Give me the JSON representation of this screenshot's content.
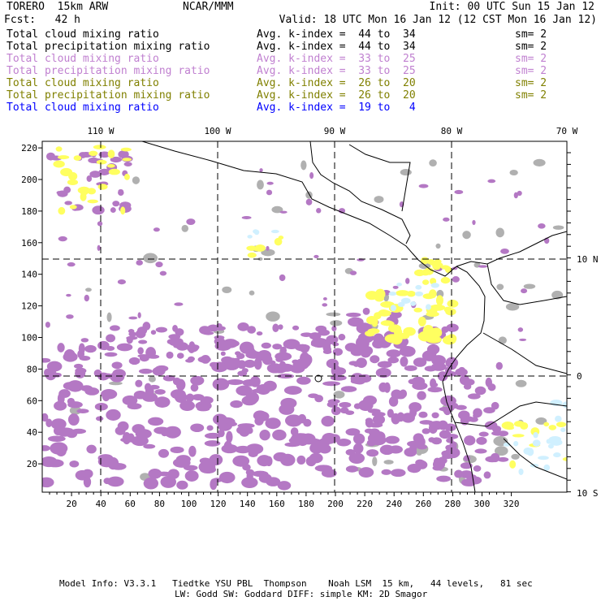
{
  "header": {
    "model": "TORERO  15km ARW",
    "org": "NCAR/MMM",
    "init": "Init: 00 UTC Sun 15 Jan 12",
    "fcst": "Fcst:   42 h",
    "valid": "Valid: 18 UTC Mon 16 Jan 12 (12 CST Mon 16 Jan 12)"
  },
  "legend": [
    {
      "field": "Total cloud mixing ratio",
      "range": "Avg. k-index =  44 to  34",
      "sm": "sm= 2",
      "color": "#000000"
    },
    {
      "field": "Total precipitation mixing ratio",
      "range": "Avg. k-index =  44 to  34",
      "sm": "sm= 2",
      "color": "#000000"
    },
    {
      "field": "Total cloud mixing ratio",
      "range": "Avg. k-index =  33 to  25",
      "sm": "sm= 2",
      "color": "#c080d0"
    },
    {
      "field": "Total precipitation mixing ratio",
      "range": "Avg. k-index =  33 to  25",
      "sm": "sm= 2",
      "color": "#c080d0"
    },
    {
      "field": "Total cloud mixing ratio",
      "range": "Avg. k-index =  26 to  20",
      "sm": "sm= 2",
      "color": "#808000"
    },
    {
      "field": "Total precipitation mixing ratio",
      "range": "Avg. k-index =  26 to  20",
      "sm": "sm= 2",
      "color": "#808000"
    },
    {
      "field": "Total cloud mixing ratio",
      "range": "Avg. k-index =  19 to   4",
      "sm": "",
      "color": "#0000ff"
    }
  ],
  "map": {
    "x_ticks": [
      "20",
      "40",
      "60",
      "80",
      "100",
      "120",
      "140",
      "160",
      "180",
      "200",
      "220",
      "240",
      "260",
      "280",
      "300",
      "320"
    ],
    "y_ticks": [
      "220",
      "200",
      "180",
      "160",
      "140",
      "120",
      "100",
      "80",
      "60",
      "40",
      "20"
    ],
    "lon_labels": [
      "110 W",
      "100 W",
      "90 W",
      "80 W",
      "70 W"
    ],
    "lat_labels": [
      "10 N",
      "0",
      "10 S"
    ],
    "colors": {
      "gray": "#b0b0b0",
      "purple": "#b478c4",
      "yellow": "#ffff60",
      "lightblue": "#d0f0ff"
    }
  },
  "footer": {
    "line1": "Model Info: V3.3.1   Tiedtke YSU PBL  Thompson    Noah LSM  15 km,   44 levels,   81 sec",
    "line2": "LW: Godd SW: Goddard DIFF: simple KM: 2D Smagor"
  }
}
